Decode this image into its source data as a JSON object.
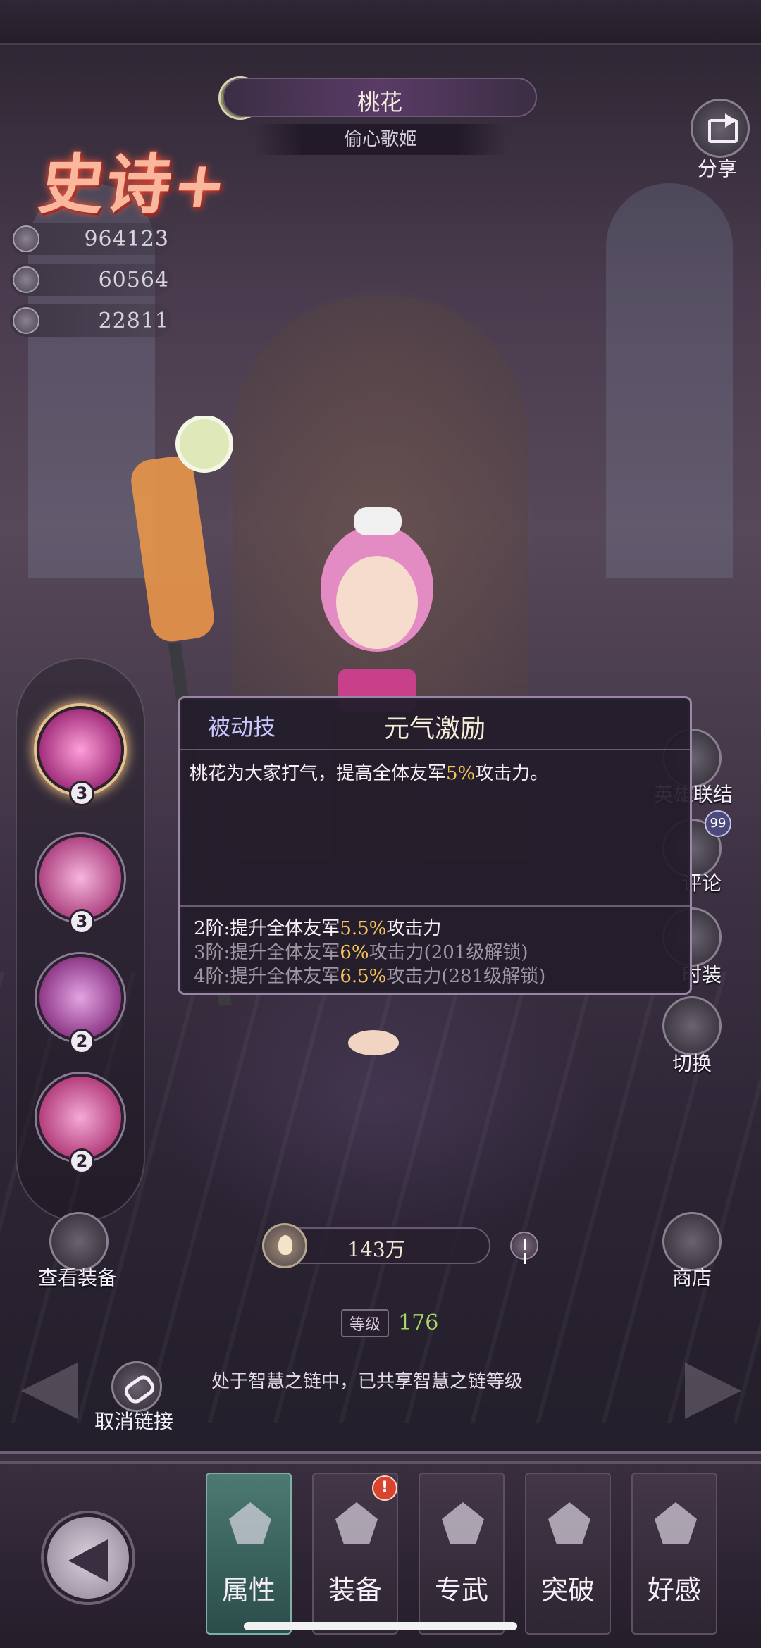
{
  "hero": {
    "name": "桃花",
    "title": "偷心歌姬",
    "rarity": "史诗+",
    "faction_icon": "leaf-icon"
  },
  "share": {
    "label": "分享",
    "icon": "share-icon"
  },
  "stats": [
    {
      "icon": "health-icon",
      "value": "964123"
    },
    {
      "icon": "attack-icon",
      "value": "60564"
    },
    {
      "icon": "defense-icon",
      "value": "22811"
    }
  ],
  "skills": [
    {
      "icon": "dancer-skill-icon",
      "level": "3"
    },
    {
      "icon": "heart-skill-icon",
      "level": "3"
    },
    {
      "icon": "music-note-skill-icon",
      "level": "2"
    },
    {
      "icon": "treble-clef-skill-icon",
      "level": "2"
    }
  ],
  "skill_popup": {
    "type": "被动技",
    "name": "元气激励",
    "desc_prefix": "桃花为大家打气，提高全体友军",
    "desc_value": "5%",
    "desc_suffix": "攻击力。",
    "tiers": [
      {
        "prefix": "2阶:提升全体友军",
        "value": "5.5%",
        "suffix": "攻击力",
        "active": true
      },
      {
        "prefix": "3阶:提升全体友军",
        "value": "6%",
        "suffix": "攻击力(201级解锁)",
        "active": false
      },
      {
        "prefix": "4阶:提升全体友军",
        "value": "6.5%",
        "suffix": "攻击力(281级解锁)",
        "active": false
      }
    ]
  },
  "side_menu": [
    {
      "label": "英雄联结",
      "icon": "hero-link-icon"
    },
    {
      "label": "评论",
      "icon": "comment-icon",
      "badge": "99"
    },
    {
      "label": "时装",
      "icon": "costume-icon"
    },
    {
      "label": "切换",
      "icon": "switch-icon"
    }
  ],
  "view_equipment": {
    "label": "查看装备",
    "icon": "equipment-icon"
  },
  "shop": {
    "label": "商店",
    "icon": "shop-icon"
  },
  "power": {
    "value": "143万",
    "icon": "flame-icon"
  },
  "level": {
    "tag": "等级",
    "value": "176"
  },
  "chain_text": "处于智慧之链中，已共享智慧之链等级",
  "unlink": {
    "label": "取消链接",
    "icon": "unlink-icon"
  },
  "tabs": [
    {
      "label": "属性",
      "icon": "attribute-icon",
      "active": true
    },
    {
      "label": "装备",
      "icon": "equipment-tab-icon",
      "alert": "!"
    },
    {
      "label": "专武",
      "icon": "exclusive-weapon-icon"
    },
    {
      "label": "突破",
      "icon": "breakthrough-icon"
    },
    {
      "label": "好感",
      "icon": "affection-icon"
    }
  ],
  "colors": {
    "highlight": "#f7c35a",
    "level_value": "#a7d86b",
    "active_tab": "#4c7a72",
    "rarity_glow": "#ff5a3a"
  }
}
